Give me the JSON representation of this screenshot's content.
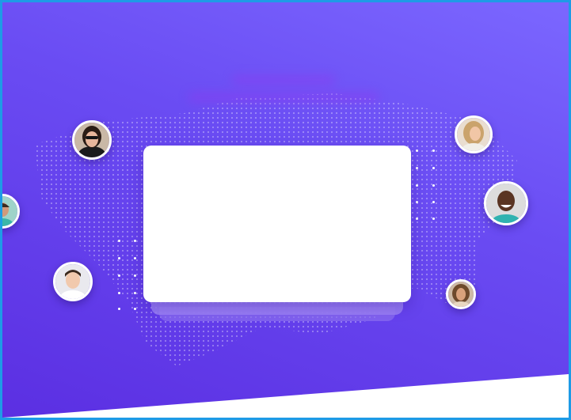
{
  "page": {
    "frame_color": "#1e9be6",
    "gradient": [
      "#7b67ff",
      "#6a4cf3",
      "#5b2fe2"
    ],
    "card_color": "#ffffff"
  },
  "avatars": [
    {
      "name": "avatar-woman-sunglasses",
      "skin": "#e8b79b",
      "hair": "#2a1c14",
      "shirt": "#1b1b1b",
      "bg": "#c9b8a6"
    },
    {
      "name": "avatar-partial-left",
      "skin": "#d19a7c",
      "hair": "#3a2a20",
      "shirt": "#3bb6a8",
      "bg": "#9fd3c9"
    },
    {
      "name": "avatar-young-man",
      "skin": "#f1c9ad",
      "hair": "#3b2a1e",
      "shirt": "#ffffff",
      "bg": "#e9e9ee"
    },
    {
      "name": "avatar-woman-blonde",
      "skin": "#f1c6a6",
      "hair": "#caa36c",
      "shirt": "#f1efe9",
      "bg": "#e9ddd0"
    },
    {
      "name": "avatar-smiling-man",
      "skin": "#5a3523",
      "hair": "#2b1b12",
      "shirt": "#2fb2b0",
      "bg": "#dcdcdc"
    },
    {
      "name": "avatar-woman-curly",
      "skin": "#d9a27c",
      "hair": "#6e4a2c",
      "shirt": "#e9d7c1",
      "bg": "#cdbaa6"
    }
  ]
}
